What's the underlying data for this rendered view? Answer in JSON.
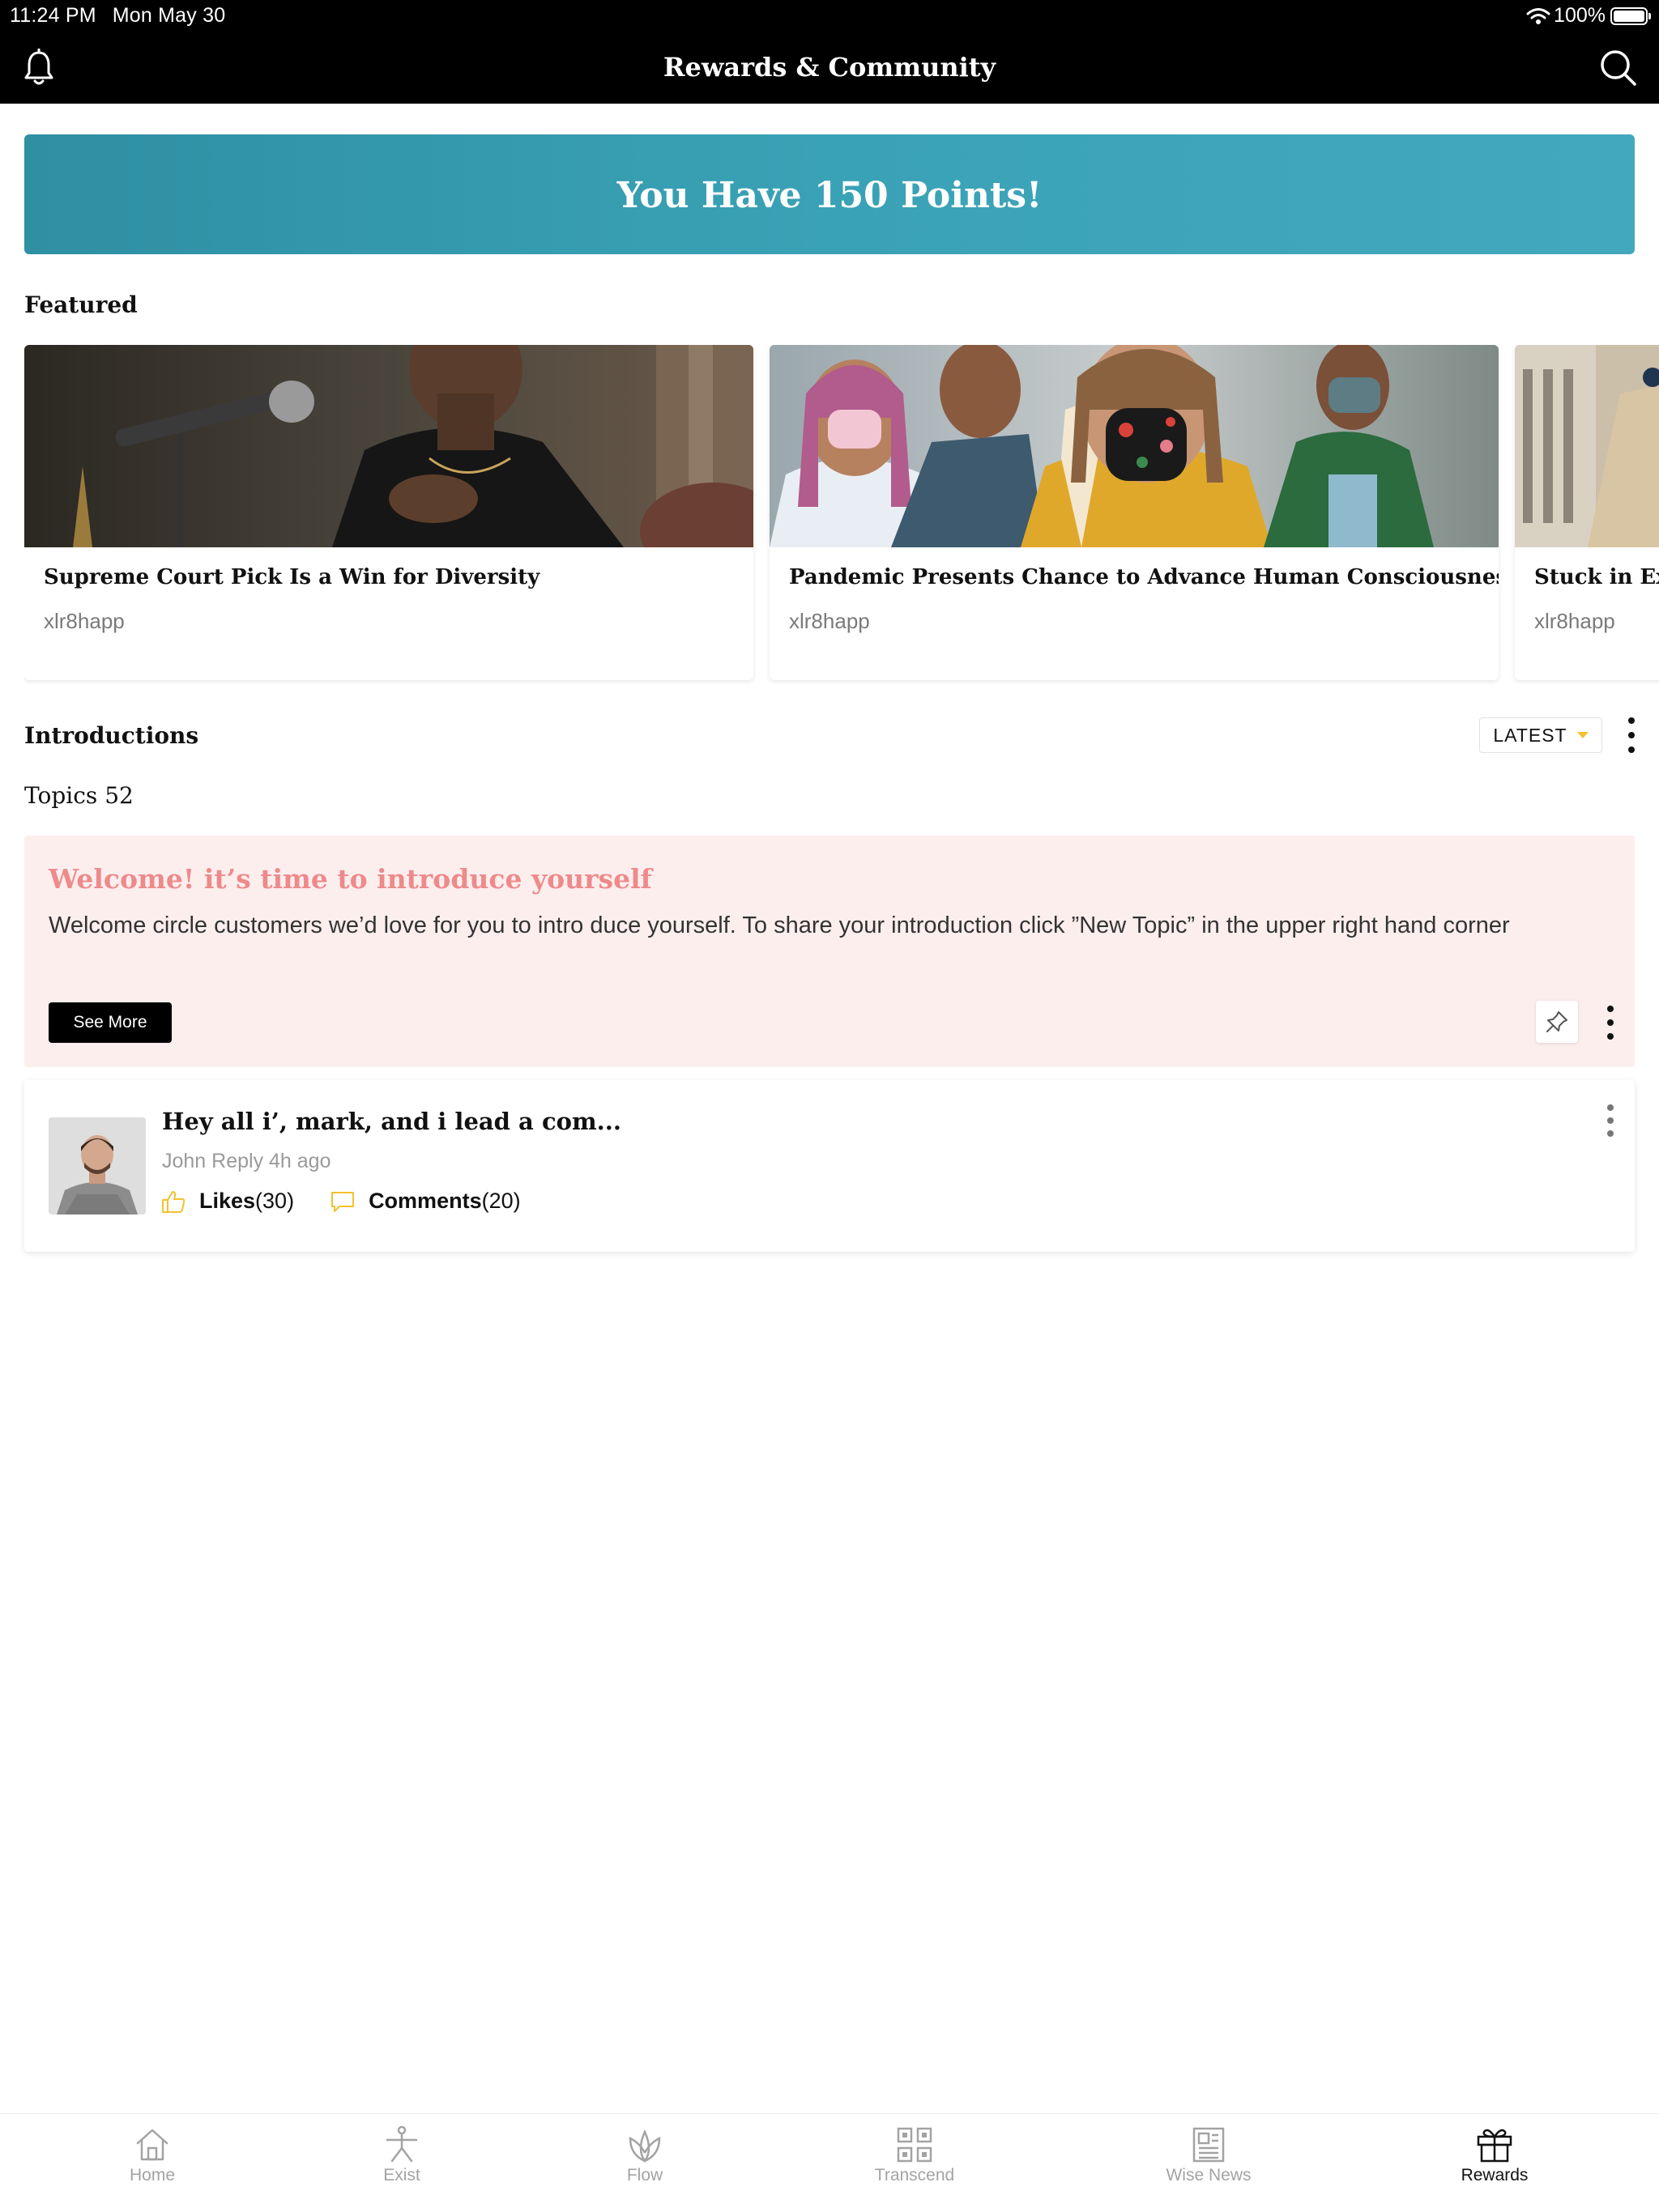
{
  "status_bar": {
    "time": "11:24 PM",
    "date": "Mon May 30",
    "battery": "100%"
  },
  "header": {
    "title": "Rewards & Community"
  },
  "points_banner": {
    "text": "You Have 150 Points!"
  },
  "featured": {
    "label": "Featured",
    "cards": [
      {
        "title": "Supreme Court Pick Is a Win for Diversity",
        "source": "xlr8happ"
      },
      {
        "title": "Pandemic Presents Chance to Advance Human Consciousness",
        "source": "xlr8happ"
      },
      {
        "title": "Stuck in Existential Crisis",
        "source": "xlr8happ"
      }
    ]
  },
  "introductions": {
    "label": "Introductions",
    "sort": "LATEST",
    "topics": "Topics 52",
    "welcome": {
      "title": "Welcome! it’s time to introduce yourself",
      "body": "Welcome circle customers we’d love for you to intro duce yourself. To share your introduction click ”New Topic” in the upper right hand corner",
      "button": "See More"
    },
    "post": {
      "title": "Hey all i’, mark, and i lead a com...",
      "meta": "John Reply 4h ago",
      "likes_label": "Likes",
      "likes_count": "(30)",
      "comments_label": "Comments",
      "comments_count": "(20)"
    }
  },
  "tabbar": {
    "items": [
      {
        "label": "Home",
        "icon": "home-icon"
      },
      {
        "label": "Exist",
        "icon": "yoga-icon"
      },
      {
        "label": "Flow",
        "icon": "leaf-icon"
      },
      {
        "label": "Transcend",
        "icon": "grid-icon"
      },
      {
        "label": "Wise News",
        "icon": "newspaper-icon"
      },
      {
        "label": "Rewards",
        "icon": "gift-icon"
      }
    ],
    "active": "Rewards"
  },
  "colors": {
    "banner": "#3aa2b6",
    "welcome_bg": "#fdeeee",
    "welcome_title": "#ee8a8a",
    "accent_yellow": "#f2c12e"
  }
}
